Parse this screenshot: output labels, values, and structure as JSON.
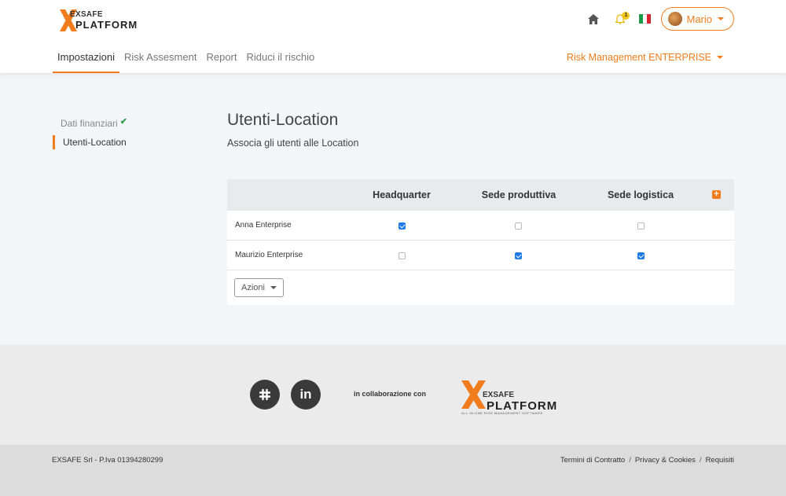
{
  "brand": {
    "top": "EXSAFE",
    "bottom": "PLATFORM",
    "accent": "#f07c1d"
  },
  "header": {
    "notifications_count": "1",
    "user_name": "Mario",
    "nav": [
      "Impostazioni",
      "Risk Assesment",
      "Report",
      "Riduci il rischio"
    ],
    "org_select": "Risk Management ENTERPRISE"
  },
  "sidebar": {
    "items": [
      {
        "label": "Dati finanziari",
        "completed": true
      },
      {
        "label": "Utenti-Location",
        "completed": false
      }
    ]
  },
  "main": {
    "title": "Utenti-Location",
    "subtitle": "Associa gli utenti alle Location",
    "columns": [
      "Headquarter",
      "Sede produttiva",
      "Sede logistica"
    ],
    "rows": [
      {
        "name": "Anna Enterprise",
        "checks": [
          true,
          false,
          false
        ]
      },
      {
        "name": "Maurizio Enterprise",
        "checks": [
          false,
          true,
          true
        ]
      }
    ],
    "actions_label": "Azioni"
  },
  "footer": {
    "collab_text": "in collaborazione con",
    "partner_logo": {
      "top": "EXSAFE",
      "bottom": "PLATFORM",
      "tagline": "ALL-IN-ONE RISK MANAGEMENT SOFTWARE"
    },
    "company": "EXSAFE Srl - P.Iva 01394280299",
    "links": [
      "Termini di Contratto",
      "Privacy & Cookies",
      "Requisiti"
    ]
  }
}
